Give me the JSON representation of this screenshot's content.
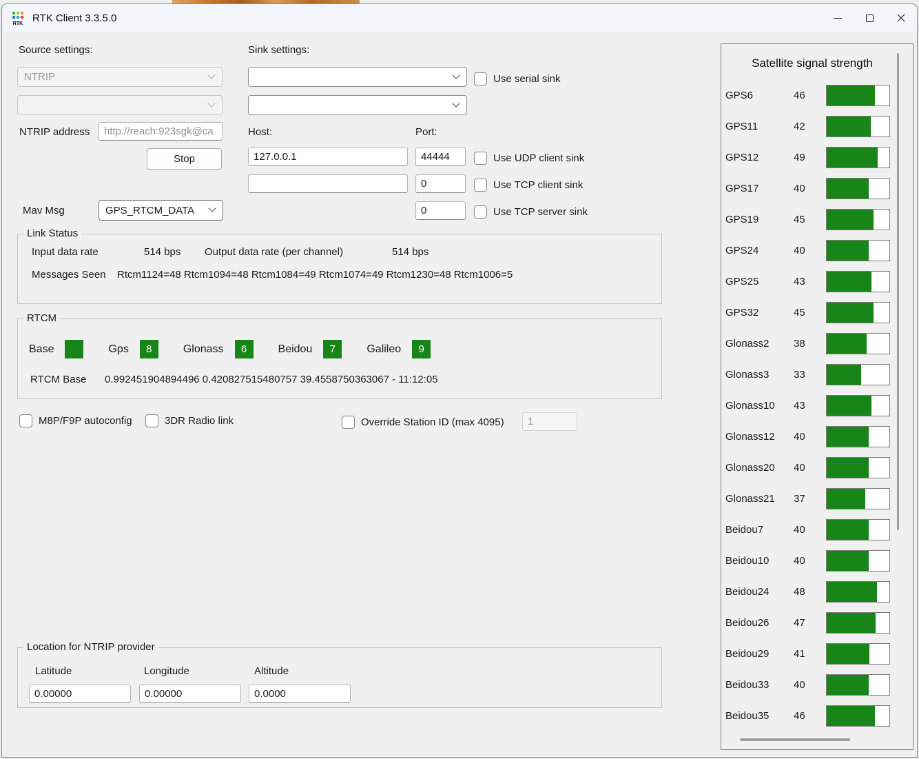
{
  "window": {
    "title": "RTK Client 3.3.5.0"
  },
  "colors": {
    "green": "#178517"
  },
  "source": {
    "label": "Source settings:",
    "combo1": "NTRIP",
    "combo2": "",
    "ntrip_address_label": "NTRIP address",
    "ntrip_address_value": "http://reach:923sgk@ca",
    "stop_button": "Stop"
  },
  "sink": {
    "label": "Sink settings:",
    "combo1": "",
    "combo2": "",
    "serial_checkbox": "Use serial sink",
    "host_label": "Host:",
    "port_label": "Port:",
    "udp_host": "127.0.0.1",
    "udp_port": "44444",
    "udp_checkbox": "Use UDP client sink",
    "tcp_client_host": "",
    "tcp_client_port": "0",
    "tcp_client_checkbox": "Use TCP client sink",
    "tcp_server_port": "0",
    "tcp_server_checkbox": "Use TCP server sink"
  },
  "mav": {
    "label": "Mav Msg",
    "value": "GPS_RTCM_DATA"
  },
  "link_status": {
    "title": "Link Status",
    "input_rate_label": "Input data rate",
    "input_rate": "514 bps",
    "output_rate_label": "Output data rate (per channel)",
    "output_rate": "514 bps",
    "messages_label": "Messages Seen",
    "messages": "Rtcm1124=48 Rtcm1094=48 Rtcm1084=49 Rtcm1074=49 Rtcm1230=48 Rtcm1006=5"
  },
  "rtcm": {
    "title": "RTCM",
    "indicators": [
      {
        "label": "Base",
        "count": ""
      },
      {
        "label": "Gps",
        "count": "8"
      },
      {
        "label": "Glonass",
        "count": "6"
      },
      {
        "label": "Beidou",
        "count": "7"
      },
      {
        "label": "Galileo",
        "count": "9"
      }
    ],
    "base_label": "RTCM Base",
    "base_value": "0.992451904894496 0.420827515480757 39.4558750363067 - 11:12:05"
  },
  "options": {
    "autoconfig_checkbox": "M8P/F9P autoconfig",
    "radio_link_checkbox": "3DR Radio link",
    "override_checkbox": "Override Station ID (max 4095)",
    "override_value": "1"
  },
  "location": {
    "title": "Location for NTRIP provider",
    "latitude_label": "Latitude",
    "longitude_label": "Longitude",
    "altitude_label": "Altitude",
    "latitude": "0.00000",
    "longitude": "0.00000",
    "altitude": "0.0000"
  },
  "satellites": {
    "title": "Satellite signal strength",
    "max_scale": 60,
    "rows": [
      {
        "name": "GPS6",
        "value": 46
      },
      {
        "name": "GPS11",
        "value": 42
      },
      {
        "name": "GPS12",
        "value": 49
      },
      {
        "name": "GPS17",
        "value": 40
      },
      {
        "name": "GPS19",
        "value": 45
      },
      {
        "name": "GPS24",
        "value": 40
      },
      {
        "name": "GPS25",
        "value": 43
      },
      {
        "name": "GPS32",
        "value": 45
      },
      {
        "name": "Glonass2",
        "value": 38
      },
      {
        "name": "Glonass3",
        "value": 33
      },
      {
        "name": "Glonass10",
        "value": 43
      },
      {
        "name": "Glonass12",
        "value": 40
      },
      {
        "name": "Glonass20",
        "value": 40
      },
      {
        "name": "Glonass21",
        "value": 37
      },
      {
        "name": "Beidou7",
        "value": 40
      },
      {
        "name": "Beidou10",
        "value": 40
      },
      {
        "name": "Beidou24",
        "value": 48
      },
      {
        "name": "Beidou26",
        "value": 47
      },
      {
        "name": "Beidou29",
        "value": 41
      },
      {
        "name": "Beidou33",
        "value": 40
      },
      {
        "name": "Beidou35",
        "value": 46
      }
    ]
  }
}
